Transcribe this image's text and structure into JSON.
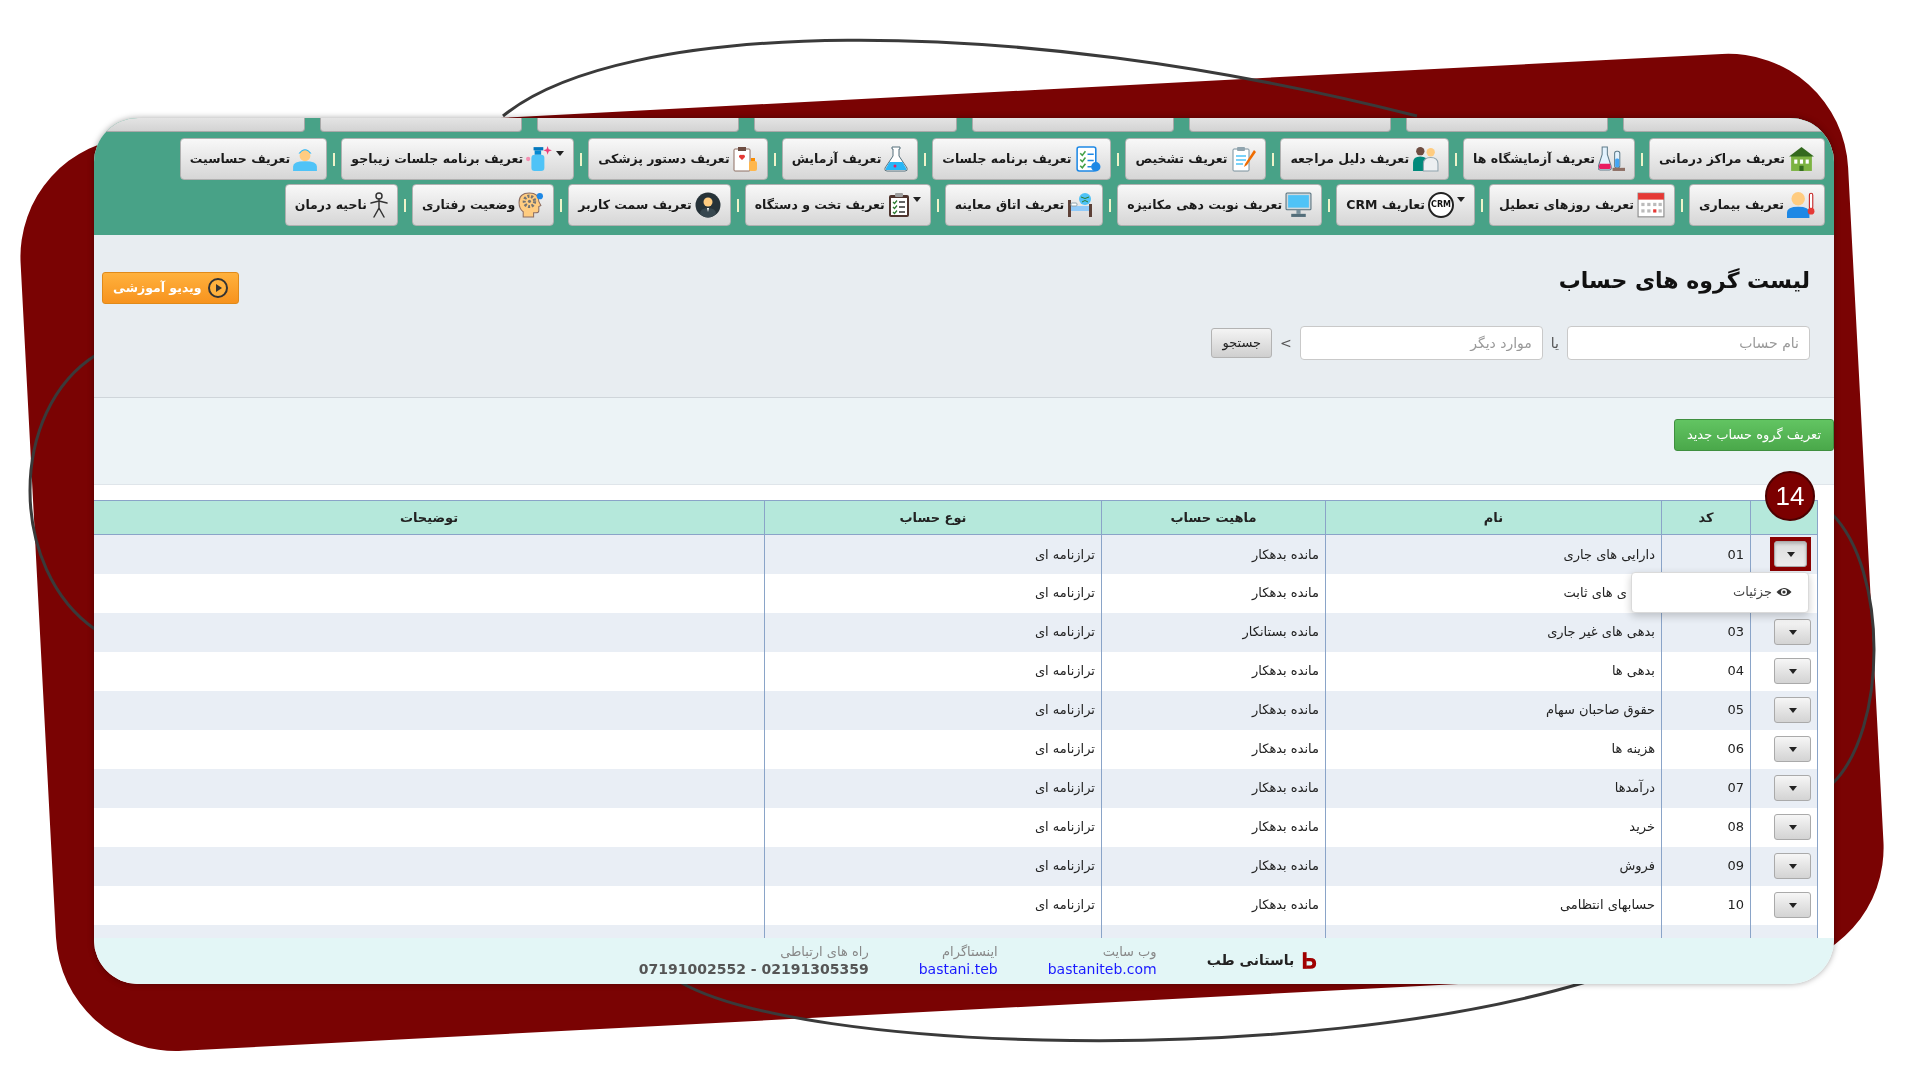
{
  "menu": {
    "cut_row": [
      {
        "kind": "button"
      },
      {
        "kind": "button"
      },
      {
        "kind": "button"
      },
      {
        "kind": "button"
      },
      {
        "kind": "button"
      },
      {
        "kind": "button"
      },
      {
        "kind": "button"
      },
      {
        "kind": "button"
      }
    ],
    "rows": [
      {
        "items": [
          {
            "label": "تعریف مراکز درمانی",
            "dropdown": false
          },
          {
            "label": "تعریف آزمایشگاه ها",
            "dropdown": false
          },
          {
            "label": "تعریف دلیل مراجعه",
            "dropdown": false
          },
          {
            "label": "تعریف تشخیص",
            "dropdown": false
          },
          {
            "label": "تعریف برنامه جلسات",
            "dropdown": false
          },
          {
            "label": "تعریف آزمایش",
            "dropdown": false
          },
          {
            "label": "تعریف دستور پزشکی",
            "dropdown": false
          },
          {
            "label": "تعریف برنامه جلسات زیباجو",
            "dropdown": true
          },
          {
            "label": "تعریف حساسیت",
            "dropdown": false
          }
        ]
      },
      {
        "items": [
          {
            "label": "تعریف بیماری",
            "dropdown": false
          },
          {
            "label": "تعریف روزهای تعطیل",
            "dropdown": false
          },
          {
            "label": "تعاریف CRM",
            "dropdown": true,
            "icon_text": "CRM"
          },
          {
            "label": "تعریف نوبت دهی مکانیزه",
            "dropdown": false
          },
          {
            "label": "تعریف اتاق معاینه",
            "dropdown": false
          },
          {
            "label": "تعریف تخت و دستگاه",
            "dropdown": true
          },
          {
            "label": "تعریف سمت کاربر",
            "dropdown": false
          },
          {
            "label": "وضعیت رفتاری",
            "dropdown": false
          },
          {
            "label": "ناحیه درمان",
            "dropdown": false
          }
        ]
      }
    ]
  },
  "video_button": {
    "label": "ویدیو آموزشی"
  },
  "page_title": "لیست گروه های حساب",
  "search": {
    "fields": [
      {
        "placeholder": "نام حساب"
      },
      {
        "placeholder": "موارد دیگر"
      }
    ],
    "joiner": "یا",
    "separator": ">",
    "button": "جستجو"
  },
  "new_button": {
    "label": "تعریف گروه حساب جدید"
  },
  "table": {
    "columns": [
      "کد",
      "نام",
      "ماهیت حساب",
      "نوع حساب",
      "توضیحات"
    ],
    "rows": [
      {
        "code": "01",
        "name": "دارایی های جاری",
        "nature": "مانده بدهکار",
        "type": "ترازنامه ای",
        "menu_open": true,
        "highlighted": true
      },
      {
        "name": "ی های ثابت",
        "nature": "مانده بدهکار",
        "type": "ترازنامه ای",
        "menu_open": false,
        "highlighted": false
      },
      {
        "code": "03",
        "name": "بدهی های غیر جاری",
        "nature": "مانده بستانکار",
        "type": "ترازنامه ای",
        "menu_open": false,
        "highlighted": false
      },
      {
        "code": "04",
        "name": "بدهی ها",
        "nature": "مانده بدهکار",
        "type": "ترازنامه ای",
        "menu_open": false,
        "highlighted": false
      },
      {
        "code": "05",
        "name": "حقوق صاحبان سهام",
        "nature": "مانده بدهکار",
        "type": "ترازنامه ای",
        "menu_open": false,
        "highlighted": false
      },
      {
        "code": "06",
        "name": "هزینه ها",
        "nature": "مانده بدهکار",
        "type": "ترازنامه ای",
        "menu_open": false,
        "highlighted": false
      },
      {
        "code": "07",
        "name": "درآمدها",
        "nature": "مانده بدهکار",
        "type": "ترازنامه ای",
        "menu_open": false,
        "highlighted": false
      },
      {
        "code": "08",
        "name": "خرید",
        "nature": "مانده بدهکار",
        "type": "ترازنامه ای",
        "menu_open": false,
        "highlighted": false
      },
      {
        "code": "09",
        "name": "فروش",
        "nature": "مانده بدهکار",
        "type": "ترازنامه ای",
        "menu_open": false,
        "highlighted": false
      },
      {
        "code": "10",
        "name": "حسابهای انتظامی",
        "nature": "مانده بدهکار",
        "type": "ترازنامه ای",
        "menu_open": false,
        "highlighted": false
      }
    ],
    "row_menu": [
      {
        "label": "جزئیات"
      }
    ]
  },
  "annotation": {
    "number": "14"
  },
  "footer": {
    "brand": "باستانی طب",
    "contacts": [
      {
        "label": "وب سایت",
        "value": "bastaniteb.com",
        "kind": "link"
      },
      {
        "label": "اینستاگرام",
        "value": "bastani.teb",
        "kind": "link"
      },
      {
        "label": "راه های ارتباطی",
        "value": "07191002552 - 02191305359",
        "kind": "phone"
      }
    ]
  }
}
